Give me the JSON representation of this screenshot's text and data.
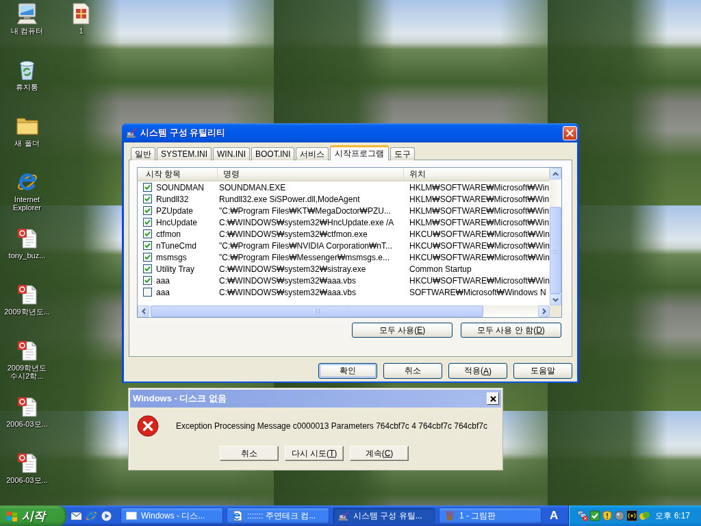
{
  "desktop": {
    "icon_columns": [
      [
        {
          "kind": "computer",
          "label": "내 컴퓨터"
        },
        {
          "kind": "recycle-bin",
          "label": "휴지통"
        },
        {
          "kind": "folder",
          "label": "새 폴더"
        },
        {
          "kind": "browser",
          "label": "Internet Explorer"
        },
        {
          "kind": "document",
          "label": "tony_buz..."
        },
        {
          "kind": "document",
          "label": "2009학년도..."
        },
        {
          "kind": "document",
          "label": "2009학년도 수시2학..."
        },
        {
          "kind": "document",
          "label": "2006-03모..."
        },
        {
          "kind": "document",
          "label": "2006-03모..."
        }
      ],
      [
        {
          "kind": "image",
          "label": "1"
        }
      ]
    ]
  },
  "config_window": {
    "title": "시스템 구성 유틸리티",
    "tabs": [
      {
        "label": "일반",
        "selected": false
      },
      {
        "label": "SYSTEM.INI",
        "selected": false
      },
      {
        "label": "WIN.INI",
        "selected": false
      },
      {
        "label": "BOOT.INI",
        "selected": false
      },
      {
        "label": "서비스",
        "selected": false
      },
      {
        "label": "시작프로그램",
        "selected": true
      },
      {
        "label": "도구",
        "selected": false
      }
    ],
    "startup_list": {
      "columns": [
        "시작 항목",
        "명령",
        "위치"
      ],
      "rows": [
        {
          "checked": true,
          "item": "SOUNDMAN",
          "command": "SOUNDMAN.EXE",
          "location": "HKLM₩SOFTWARE₩Microsoft₩Win"
        },
        {
          "checked": true,
          "item": "Rundll32",
          "command": "Rundll32.exe SiSPower.dll,ModeAgent",
          "location": "HKLM₩SOFTWARE₩Microsoft₩Win"
        },
        {
          "checked": true,
          "item": "PZUpdate",
          "command": "\"C:₩Program Files₩KT₩MegaDoctor₩PZU...",
          "location": "HKLM₩SOFTWARE₩Microsoft₩Win"
        },
        {
          "checked": true,
          "item": "HncUpdate",
          "command": "C:₩WINDOWS₩system32₩HncUpdate.exe /A",
          "location": "HKLM₩SOFTWARE₩Microsoft₩Win"
        },
        {
          "checked": true,
          "item": "ctfmon",
          "command": "C:₩WINDOWS₩system32₩ctfmon.exe",
          "location": "HKCU₩SOFTWARE₩Microsoft₩Win"
        },
        {
          "checked": true,
          "item": "nTuneCmd",
          "command": "\"C:₩Program Files₩NVIDIA Corporation₩nT...",
          "location": "HKCU₩SOFTWARE₩Microsoft₩Win"
        },
        {
          "checked": true,
          "item": "msmsgs",
          "command": "\"C:₩Program Files₩Messenger₩msmsgs.e...",
          "location": "HKCU₩SOFTWARE₩Microsoft₩Win"
        },
        {
          "checked": true,
          "item": "Utility Tray",
          "command": "C:₩WINDOWS₩system32₩sistray.exe",
          "location": "Common Startup"
        },
        {
          "checked": true,
          "item": "aaa",
          "command": "C:₩WINDOWS₩system32₩aaa.vbs",
          "location": "HKCU₩SOFTWARE₩Microsoft₩Win"
        },
        {
          "checked": false,
          "item": "aaa",
          "command": "C:₩WINDOWS₩system32₩aaa.vbs",
          "location": "SOFTWARE₩Microsoft₩Windows N"
        }
      ]
    },
    "list_buttons": [
      {
        "label": "모두 사용(",
        "access_key": "E",
        "label_end": ")"
      },
      {
        "label": "모두 사용 안 함(",
        "access_key": "D",
        "label_end": ")"
      }
    ],
    "dialog_buttons": [
      {
        "label": "확인",
        "default": true
      },
      {
        "label": "취소",
        "default": false
      },
      {
        "label": "적용(",
        "access_key": "A",
        "label_end": ")",
        "default": false
      },
      {
        "label": "도움말",
        "default": false
      }
    ]
  },
  "error_dialog": {
    "title": "Windows - 디스크 없음",
    "message": "Exception Processing Message c0000013 Parameters 764cbf7c 4 764cbf7c 764cbf7c",
    "buttons": [
      {
        "label": "취소"
      },
      {
        "label": "다시 시도(",
        "access_key": "T",
        "label_end": ")"
      },
      {
        "label": "계속(",
        "access_key": "C",
        "label_end": ")"
      }
    ]
  },
  "taskbar": {
    "start_label": "시작",
    "tasks": [
      {
        "kind": "window",
        "label": "Windows - 디스...",
        "selected": false
      },
      {
        "kind": "web-page",
        "label": "::::::: 주연테크 컴...",
        "selected": false
      },
      {
        "kind": "config",
        "label": "시스템 구성 유틸...",
        "selected": true
      },
      {
        "kind": "paint",
        "label": "1 - 그림판",
        "selected": false
      }
    ],
    "language": "A",
    "clock": "오후 6:17"
  }
}
